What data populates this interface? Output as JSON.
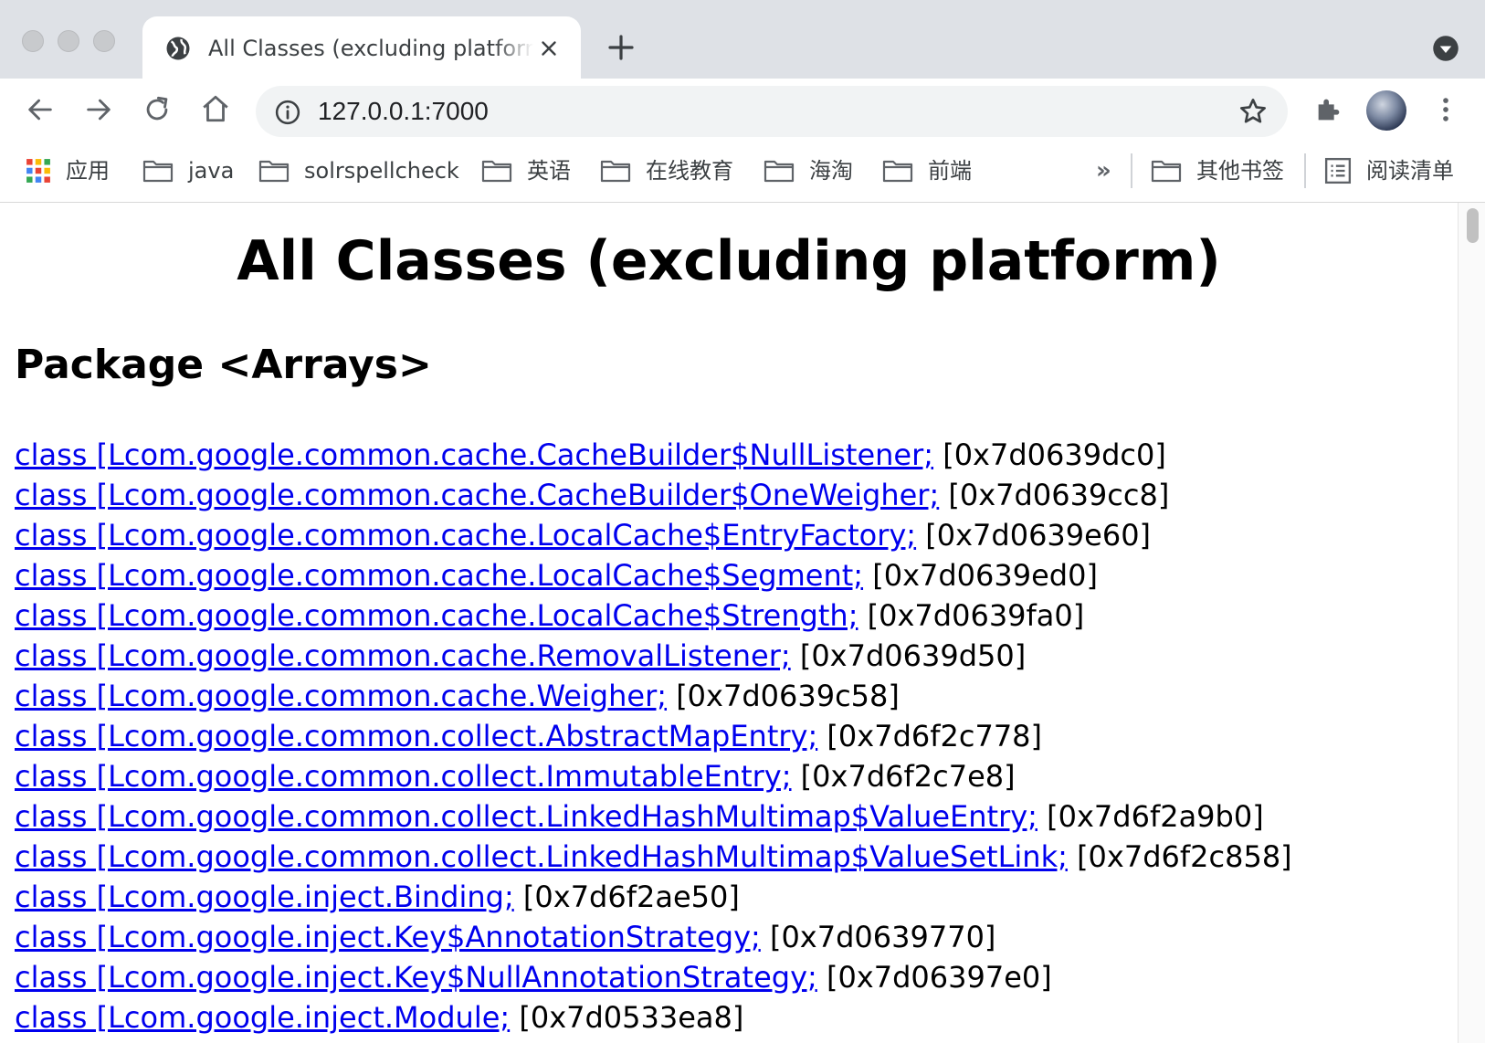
{
  "browser": {
    "tab": {
      "title": "All Classes (excluding platform)"
    },
    "address_bar": {
      "url": "127.0.0.1:7000"
    },
    "bookmarks": [
      {
        "label": "应用",
        "icon": "apps-grid-icon"
      },
      {
        "label": "java",
        "icon": "folder-icon"
      },
      {
        "label": "solrspellcheck",
        "icon": "folder-icon"
      },
      {
        "label": "英语",
        "icon": "folder-icon"
      },
      {
        "label": "在线教育",
        "icon": "folder-icon"
      },
      {
        "label": "海淘",
        "icon": "folder-icon"
      },
      {
        "label": "前端",
        "icon": "folder-icon"
      }
    ],
    "overflow_label": "»",
    "other_bookmarks": "其他书签",
    "reading_list": "阅读清单"
  },
  "page": {
    "title": "All Classes (excluding platform)",
    "package_heading": "Package <Arrays>",
    "classes": [
      {
        "name": "class [Lcom.google.common.cache.CacheBuilder$NullListener;",
        "addr": "[0x7d0639dc0]"
      },
      {
        "name": "class [Lcom.google.common.cache.CacheBuilder$OneWeigher;",
        "addr": "[0x7d0639cc8]"
      },
      {
        "name": "class [Lcom.google.common.cache.LocalCache$EntryFactory;",
        "addr": "[0x7d0639e60]"
      },
      {
        "name": "class [Lcom.google.common.cache.LocalCache$Segment;",
        "addr": "[0x7d0639ed0]"
      },
      {
        "name": "class [Lcom.google.common.cache.LocalCache$Strength;",
        "addr": "[0x7d0639fa0]"
      },
      {
        "name": "class [Lcom.google.common.cache.RemovalListener;",
        "addr": "[0x7d0639d50]"
      },
      {
        "name": "class [Lcom.google.common.cache.Weigher;",
        "addr": "[0x7d0639c58]"
      },
      {
        "name": "class [Lcom.google.common.collect.AbstractMapEntry;",
        "addr": "[0x7d6f2c778]"
      },
      {
        "name": "class [Lcom.google.common.collect.ImmutableEntry;",
        "addr": "[0x7d6f2c7e8]"
      },
      {
        "name": "class [Lcom.google.common.collect.LinkedHashMultimap$ValueEntry;",
        "addr": "[0x7d6f2a9b0]"
      },
      {
        "name": "class [Lcom.google.common.collect.LinkedHashMultimap$ValueSetLink;",
        "addr": "[0x7d6f2c858]"
      },
      {
        "name": "class [Lcom.google.inject.Binding;",
        "addr": "[0x7d6f2ae50]"
      },
      {
        "name": "class [Lcom.google.inject.Key$AnnotationStrategy;",
        "addr": "[0x7d0639770]"
      },
      {
        "name": "class [Lcom.google.inject.Key$NullAnnotationStrategy;",
        "addr": "[0x7d06397e0]"
      },
      {
        "name": "class [Lcom.google.inject.Module;",
        "addr": "[0x7d0533ea8]"
      }
    ]
  },
  "colors": {
    "link": "#0000ee",
    "tabstrip_bg": "#dee1e6",
    "omnibox_bg": "#f1f3f4"
  }
}
